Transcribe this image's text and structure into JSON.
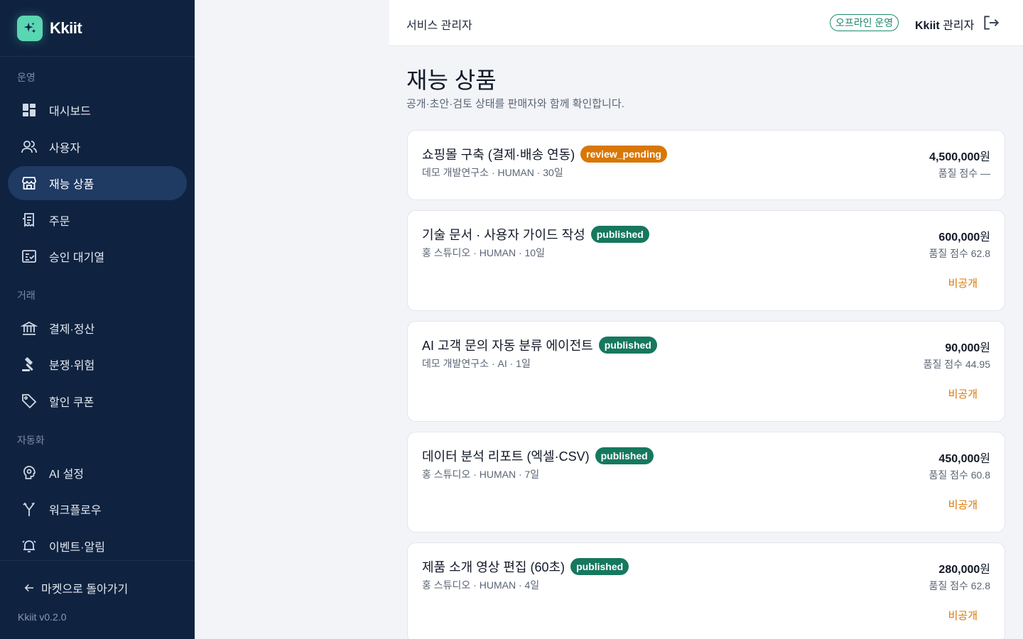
{
  "brand": {
    "name": "Kkiit",
    "logo_icon": "sparkles-icon",
    "accent": "#5ad6b2"
  },
  "sidebar": {
    "sections": [
      {
        "label": "운영"
      },
      {
        "label": "거래"
      },
      {
        "label": "자동화"
      }
    ],
    "items": [
      {
        "label": "대시보드",
        "icon": "dashboard-icon"
      },
      {
        "label": "사용자",
        "icon": "users-icon"
      },
      {
        "label": "재능 상품",
        "icon": "storefront-icon",
        "active": true
      },
      {
        "label": "주문",
        "icon": "receipt-icon"
      },
      {
        "label": "승인 대기열",
        "icon": "checklist-icon"
      },
      {
        "label": "결제·정산",
        "icon": "bank-icon"
      },
      {
        "label": "분쟁·위험",
        "icon": "gavel-icon"
      },
      {
        "label": "할인 쿠폰",
        "icon": "tag-icon"
      },
      {
        "label": "AI 설정",
        "icon": "ai-settings-icon"
      },
      {
        "label": "워크플로우",
        "icon": "workflow-icon"
      },
      {
        "label": "이벤트·알림",
        "icon": "alarm-icon"
      }
    ],
    "back_label": "마켓으로 돌아가기",
    "version": "Kkiit v0.2.0"
  },
  "header": {
    "title": "서비스 관리자",
    "mode_badge": "오프라인 운영",
    "admin_brand": "Kkiit",
    "admin_role": "관리자"
  },
  "main": {
    "title": "재능 상품",
    "subtitle": "공개·초안·검토 상태를 판매자와 함께 확인합니다."
  },
  "products": [
    {
      "title": "쇼핑몰 구축 (결제·배송 연동)",
      "status": "review_pending",
      "meta": "데모 개발연구소 · HUMAN · 30일",
      "price": "4,500,000",
      "currency": "원",
      "score": "품질 점수 —",
      "action": ""
    },
    {
      "title": "기술 문서 · 사용자 가이드 작성",
      "status": "published",
      "meta": "홍 스튜디오 · HUMAN · 10일",
      "price": "600,000",
      "currency": "원",
      "score": "품질 점수 62.8",
      "action": "비공개"
    },
    {
      "title": "AI 고객 문의 자동 분류 에이전트",
      "status": "published",
      "meta": "데모 개발연구소 · AI · 1일",
      "price": "90,000",
      "currency": "원",
      "score": "품질 점수 44.95",
      "action": "비공개"
    },
    {
      "title": "데이터 분석 리포트 (엑셀·CSV)",
      "status": "published",
      "meta": "홍 스튜디오 · HUMAN · 7일",
      "price": "450,000",
      "currency": "원",
      "score": "품질 점수 60.8",
      "action": "비공개"
    },
    {
      "title": "제품 소개 영상 편집 (60초)",
      "status": "published",
      "meta": "홍 스튜디오 · HUMAN · 4일",
      "price": "280,000",
      "currency": "원",
      "score": "품질 점수 62.8",
      "action": "비공개"
    }
  ],
  "colors": {
    "sidebar_bg": "#0f2340",
    "active_item_bg": "#1f3a63",
    "pending": "#d97706",
    "published": "#16785e",
    "action_link": "#d97706"
  }
}
